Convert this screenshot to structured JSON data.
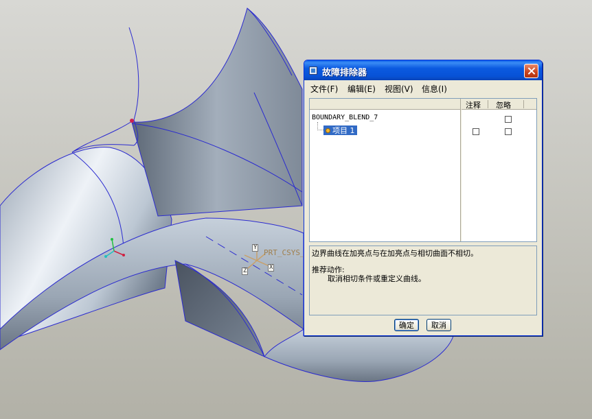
{
  "viewport": {
    "csys_label": "PRT_CSYS_DEF",
    "axis_letters": {
      "x": "X",
      "y": "Y",
      "z": "Z"
    }
  },
  "dialog": {
    "title": "故障排除器",
    "menu": [
      {
        "label": "文件(F)"
      },
      {
        "label": "编辑(E)"
      },
      {
        "label": "视图(V)"
      },
      {
        "label": "信息(I)"
      }
    ],
    "columns": {
      "note": "注释",
      "ignore": "忽略"
    },
    "tree": {
      "root": "BOUNDARY_BLEND_7",
      "item": "项目 1"
    },
    "message": {
      "line1": "边界曲线在加亮点与在加亮点与相切曲面不相切。",
      "action_heading": "推荐动作:",
      "action_text": "取消相切条件或重定义曲线。"
    },
    "buttons": {
      "ok": "确定",
      "cancel": "取消"
    }
  }
}
